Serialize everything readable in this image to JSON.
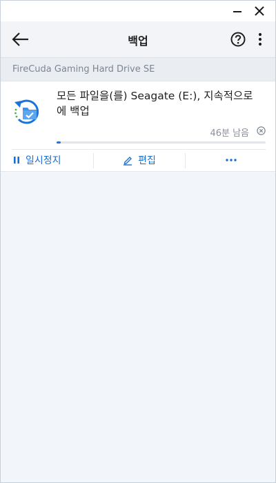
{
  "colors": {
    "accent": "#1a73d9",
    "page_background": "#f2f5f9",
    "header_background": "#f2f4f7",
    "muted_text": "#7c8591"
  },
  "window": {
    "minimize_icon": "minimize-icon",
    "close_icon": "close-icon"
  },
  "appbar": {
    "title": "백업",
    "back_icon": "arrow-left-icon",
    "help_icon": "question-circle-icon",
    "more_icon": "more-vertical-icon"
  },
  "device": {
    "name": "FireCuda Gaming Hard Drive SE"
  },
  "backup": {
    "icon": "folder-sync-icon",
    "description": "모든 파일을(를) Seagate (E:), 지속적으로 에 백업",
    "time_remaining": "46분 남음",
    "cancel_icon": "cancel-circle-icon",
    "progress": 0.02
  },
  "actions": {
    "pause_label": "일시정지",
    "pause_icon": "pause-icon",
    "edit_label": "편집",
    "edit_icon": "pencil-icon",
    "more_icon": "more-horizontal-icon"
  }
}
